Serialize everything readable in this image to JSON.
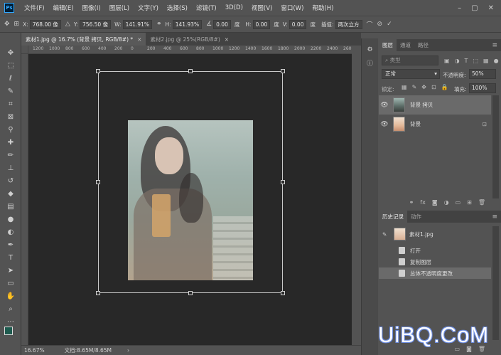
{
  "app": {
    "logo": "Ps"
  },
  "menu": [
    "文件(F)",
    "编辑(E)",
    "图像(I)",
    "图层(L)",
    "文字(Y)",
    "选择(S)",
    "滤镜(T)",
    "3D(D)",
    "视图(V)",
    "窗口(W)",
    "帮助(H)"
  ],
  "window_controls": {
    "minimize": "–",
    "maximize": "▢",
    "close": "✕"
  },
  "options": {
    "x_label": "X:",
    "x_value": "768.00 像",
    "y_label": "Y:",
    "y_value": "756.50 像",
    "w_label": "W:",
    "w_value": "141.91%",
    "h_label": "H:",
    "h_value": "141.93%",
    "angle_value": "0.00",
    "angle_unit": "度",
    "hskew_label": "H:",
    "hskew_value": "0.00",
    "hskew_unit": "度",
    "vskew_label": "V:",
    "vskew_value": "0.00",
    "vskew_unit": "度",
    "interp_label": "插值:",
    "interp_value": "两次立方"
  },
  "tabs": [
    {
      "label": "素材1.jpg @ 16.7% (背景 拷贝, RGB/8#) *",
      "close": "×"
    },
    {
      "label": "素材2.jpg @ 25%(RGB/8#)",
      "close": "×"
    }
  ],
  "ruler_ticks": [
    "1200",
    "1000",
    "800",
    "600",
    "400",
    "200",
    "0",
    "200",
    "400",
    "600",
    "800",
    "1000",
    "1200",
    "1400",
    "1600",
    "1800",
    "2000",
    "2200",
    "2400",
    "2600"
  ],
  "status": {
    "zoom": "16.67%",
    "doc": "文档:8.65M/8.65M",
    "arrow": "›"
  },
  "layers_panel": {
    "tabs": [
      "图层",
      "通道",
      "路径"
    ],
    "kind_placeholder": "类型",
    "blend_mode": "正常",
    "opacity_label": "不透明度:",
    "opacity_value": "50%",
    "lock_label": "锁定:",
    "fill_label": "填充:",
    "fill_value": "100%",
    "layers": [
      {
        "name": "背景 拷贝",
        "selected": true
      },
      {
        "name": "背景",
        "locked": true
      }
    ]
  },
  "history_panel": {
    "tabs": [
      "历史记录",
      "动作"
    ],
    "snapshot": "素材1.jpg",
    "items": [
      "打开",
      "复制图层",
      "总体不透明度更改"
    ]
  },
  "watermark": "UiBQ.CoM",
  "colors": {
    "accent": "#31a8ff",
    "canvas_bg": "#282828",
    "panel_bg": "#535353"
  }
}
